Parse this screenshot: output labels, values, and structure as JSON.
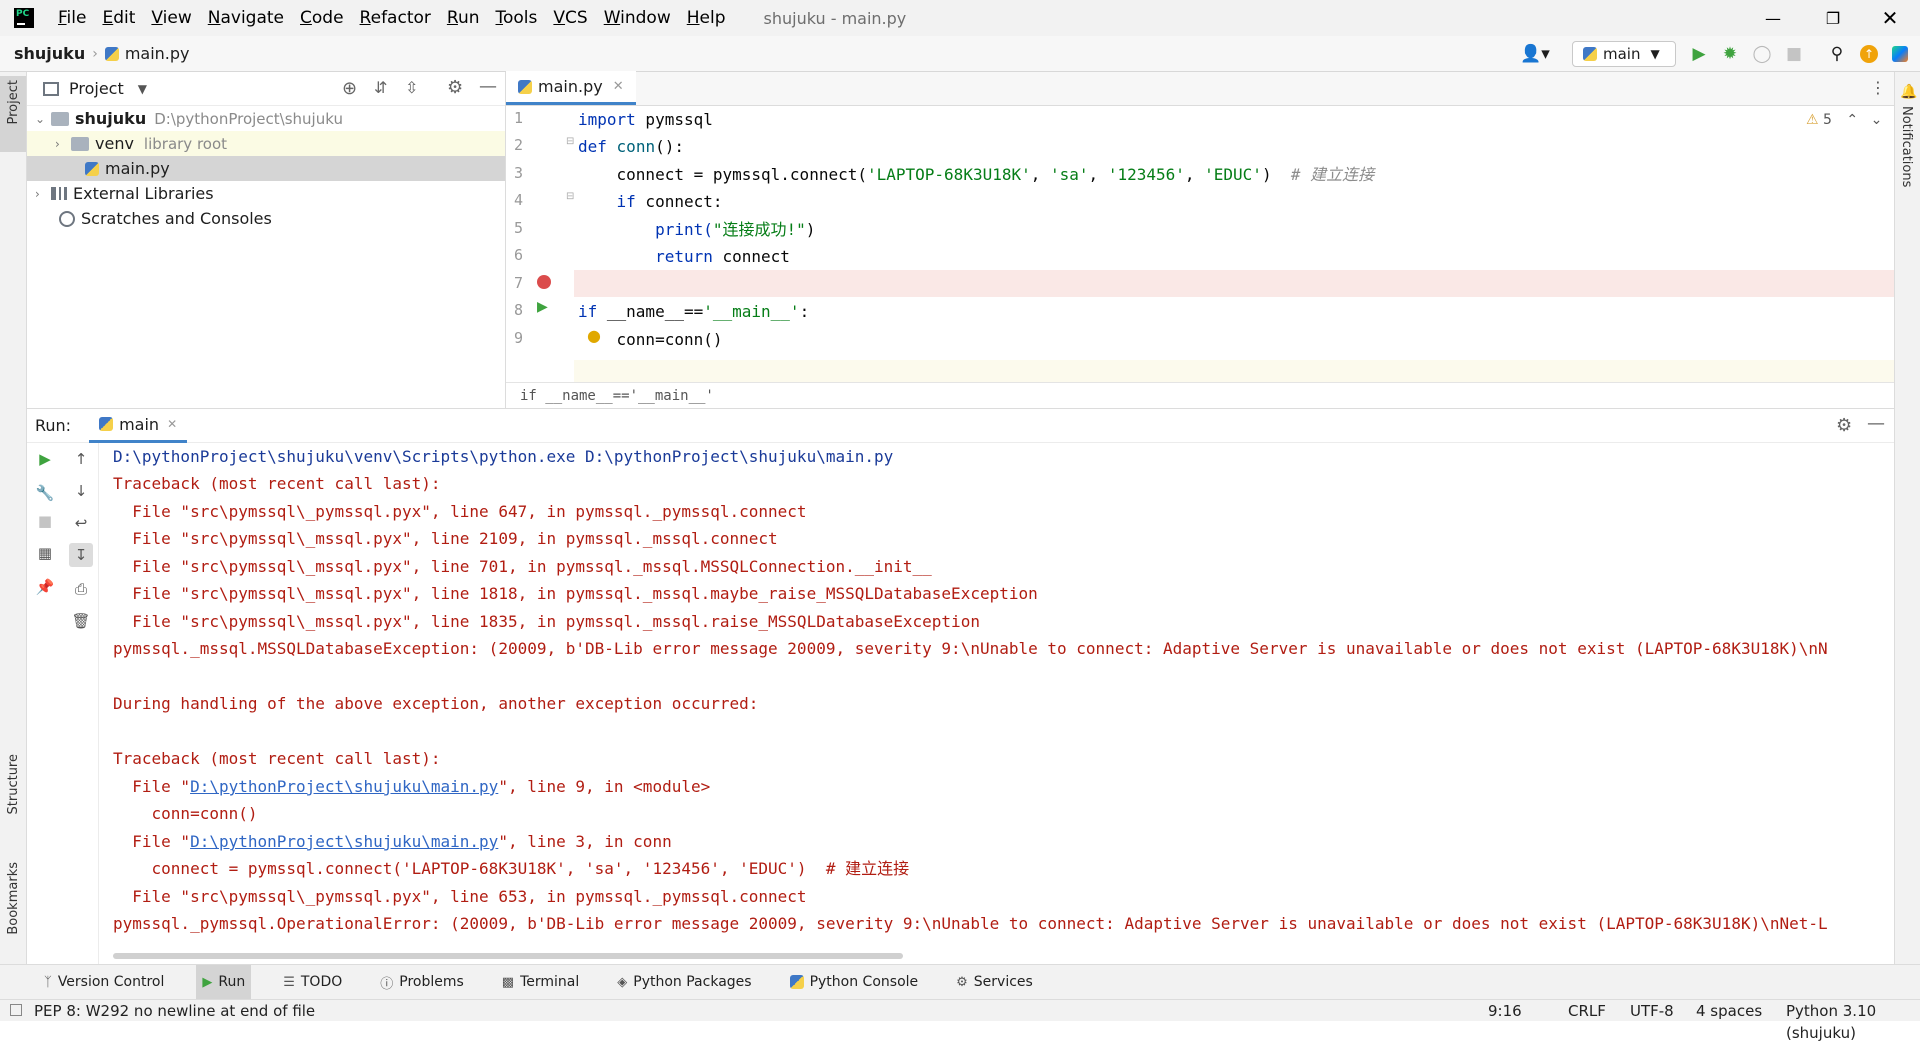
{
  "titlebar": {
    "menu": [
      "File",
      "Edit",
      "View",
      "Navigate",
      "Code",
      "Refactor",
      "Run",
      "Tools",
      "VCS",
      "Window",
      "Help"
    ],
    "title": "shujuku - main.py"
  },
  "navbar": {
    "project": "shujuku",
    "file": "main.py",
    "run_config": "main"
  },
  "project_panel": {
    "title": "Project",
    "tree": {
      "root_name": "shujuku",
      "root_path": "D:\\pythonProject\\shujuku",
      "venv_name": "venv",
      "venv_note": "library root",
      "file": "main.py",
      "external": "External Libraries",
      "scratches": "Scratches and Consoles"
    }
  },
  "left_stripe": {
    "project": "Project",
    "structure": "Structure",
    "bookmarks": "Bookmarks"
  },
  "right_stripe": {
    "notifications": "Notifications"
  },
  "editor": {
    "tab": "main.py",
    "warnings_count": "5",
    "line_numbers": [
      "1",
      "2",
      "3",
      "4",
      "5",
      "6",
      "7",
      "8",
      "9"
    ],
    "code": {
      "l1_kw": "import",
      "l1_rest": " pymssql",
      "l2_kw": "def",
      "l2_fn": "conn",
      "l2_rest": "():",
      "l3_a": "    connect = pymssql.connect(",
      "l3_s1": "'LAPTOP-68K3U18K'",
      "l3_c1": ", ",
      "l3_s2": "'sa'",
      "l3_c2": ", ",
      "l3_s3": "'123456'",
      "l3_c3": ", ",
      "l3_s4": "'EDUC'",
      "l3_b": ")  ",
      "l3_cmt": "# 建立连接",
      "l4_kw": "if",
      "l4_rest": " connect:",
      "l5_a": "print(",
      "l5_s": "\"连接成功!\"",
      "l5_b": ")",
      "l6_kw": "return",
      "l6_rest": " connect",
      "l8_kw": "if",
      "l8_d": " __name__",
      "l8_eq": "==",
      "l8_s": "'__main__'",
      "l8_c": ":",
      "l9": "conn=conn()"
    },
    "breadcrumb": "if __name__=='__main__'"
  },
  "run_panel": {
    "label": "Run:",
    "tab": "main",
    "lines": [
      "D:\\pythonProject\\shujuku\\venv\\Scripts\\python.exe D:\\pythonProject\\shujuku\\main.py",
      "Traceback (most recent call last):",
      "  File \"src\\pymssql\\_pymssql.pyx\", line 647, in pymssql._pymssql.connect",
      "  File \"src\\pymssql\\_mssql.pyx\", line 2109, in pymssql._mssql.connect",
      "  File \"src\\pymssql\\_mssql.pyx\", line 701, in pymssql._mssql.MSSQLConnection.__init__",
      "  File \"src\\pymssql\\_mssql.pyx\", line 1818, in pymssql._mssql.maybe_raise_MSSQLDatabaseException",
      "  File \"src\\pymssql\\_mssql.pyx\", line 1835, in pymssql._mssql.raise_MSSQLDatabaseException",
      "pymssql._mssql.MSSQLDatabaseException: (20009, b'DB-Lib error message 20009, severity 9:\\nUnable to connect: Adaptive Server is unavailable or does not exist (LAPTOP-68K3U18K)\\nN",
      "",
      "During handling of the above exception, another exception occurred:",
      "",
      "Traceback (most recent call last):"
    ],
    "link_line1_pre": "  File \"",
    "link_path": "D:\\pythonProject\\shujuku\\main.py",
    "link_line1_post": "\", line 9, in <module>",
    "line_conn": "    conn=conn()",
    "link_line2_post": "\", line 3, in conn",
    "line_connect": "    connect = pymssql.connect('LAPTOP-68K3U18K', 'sa', '123456', 'EDUC')  # 建立连接",
    "line_653": "  File \"src\\pymssql\\_pymssql.pyx\", line 653, in pymssql._pymssql.connect",
    "line_last": "pymssql._pymssql.OperationalError: (20009, b'DB-Lib error message 20009, severity 9:\\nUnable to connect: Adaptive Server is unavailable or does not exist (LAPTOP-68K3U18K)\\nNet-L"
  },
  "toolstrip": [
    "Version Control",
    "Run",
    "TODO",
    "Problems",
    "Terminal",
    "Python Packages",
    "Python Console",
    "Services"
  ],
  "statusbar": {
    "message": "PEP 8: W292 no newline at end of file",
    "position": "9:16",
    "line_sep": "CRLF",
    "encoding": "UTF-8",
    "indent": "4 spaces",
    "interpreter": "Python 3.10 (shujuku)"
  },
  "colors": {
    "accent": "#4083c9",
    "error_text": "#b11d12",
    "breakpoint": "#db4c4c",
    "run_green": "#3fa33f"
  }
}
